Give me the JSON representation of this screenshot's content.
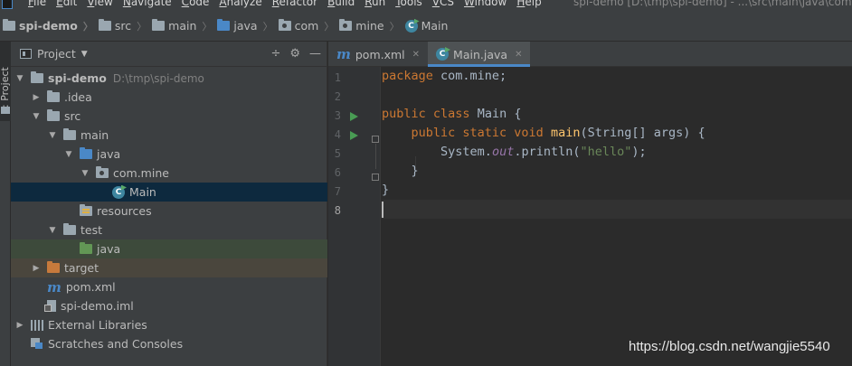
{
  "menubar": {
    "items": [
      "File",
      "Edit",
      "View",
      "Navigate",
      "Code",
      "Analyze",
      "Refactor",
      "Build",
      "Run",
      "Tools",
      "VCS",
      "Window",
      "Help"
    ],
    "window_title": "spi-demo [D:\\tmp\\spi-demo] - ...\\src\\main\\java\\com\\"
  },
  "breadcrumb": {
    "project": "spi-demo",
    "items": [
      "src",
      "main",
      "java",
      "com",
      "mine"
    ],
    "file": "Main"
  },
  "sidestrip": {
    "tab_label": "1: Project"
  },
  "project_panel": {
    "title": "Project",
    "tools": {
      "collapse": "÷",
      "settings": "⚙",
      "hide": "—"
    },
    "tree": [
      {
        "label": "spi-demo",
        "path": "D:\\tmp\\spi-demo",
        "depth": 0,
        "arrow": "down",
        "icon": "project-folder-icon",
        "bold": true
      },
      {
        "label": ".idea",
        "depth": 1,
        "arrow": "right",
        "icon": "folder-icon"
      },
      {
        "label": "src",
        "depth": 1,
        "arrow": "down",
        "icon": "folder-icon"
      },
      {
        "label": "main",
        "depth": 2,
        "arrow": "down",
        "icon": "folder-icon"
      },
      {
        "label": "java",
        "depth": 3,
        "arrow": "down",
        "icon": "source-folder-icon"
      },
      {
        "label": "com.mine",
        "depth": 4,
        "arrow": "down",
        "icon": "package-icon"
      },
      {
        "label": "Main",
        "depth": 5,
        "arrow": "none",
        "icon": "class-icon",
        "selected": true
      },
      {
        "label": "resources",
        "depth": 3,
        "arrow": "none",
        "icon": "resources-folder-icon"
      },
      {
        "label": "test",
        "depth": 2,
        "arrow": "down",
        "icon": "folder-icon"
      },
      {
        "label": "java",
        "depth": 3,
        "arrow": "none",
        "icon": "test-folder-icon",
        "highlight": "green"
      },
      {
        "label": "target",
        "depth": 1,
        "arrow": "right",
        "icon": "excluded-folder-icon",
        "highlight": "brown"
      },
      {
        "label": "pom.xml",
        "depth": 1,
        "arrow": "none",
        "icon": "maven-icon"
      },
      {
        "label": "spi-demo.iml",
        "depth": 1,
        "arrow": "none",
        "icon": "iml-file-icon"
      },
      {
        "label": "External Libraries",
        "depth": 0,
        "arrow": "right",
        "icon": "libraries-icon"
      },
      {
        "label": "Scratches and Consoles",
        "depth": 0,
        "arrow": "none",
        "icon": "scratches-icon"
      }
    ]
  },
  "editor": {
    "tabs": [
      {
        "label": "pom.xml",
        "icon": "maven-icon",
        "active": false
      },
      {
        "label": "Main.java",
        "icon": "class-icon",
        "active": true
      }
    ],
    "line_numbers": [
      "1",
      "2",
      "3",
      "4",
      "5",
      "6",
      "7",
      "8"
    ],
    "current_line": 8,
    "code": {
      "l1_kw": "package",
      "l1_rest": " com.mine;",
      "l3_kw": "public class",
      "l3_name": "Main",
      "l3_rest": " {",
      "l4_kw": "public static void",
      "l4_fn": "main",
      "l4_rest": "(String[] args) {",
      "l5_pre": "System.",
      "l5_field": "out",
      "l5_mid": ".println(",
      "l5_str": "\"hello\"",
      "l5_end": ");",
      "l6": "}",
      "l7": "}"
    }
  },
  "watermark": "https://blog.csdn.net/wangjie5540",
  "colors": {
    "background": "#2b2b2b",
    "panel": "#3c3f41",
    "selection": "#0d293e",
    "keyword": "#cc7832",
    "string": "#6a8759",
    "function": "#ffc66d",
    "static_field": "#9876aa",
    "accent": "#4a88c7",
    "run_green": "#499c54"
  }
}
